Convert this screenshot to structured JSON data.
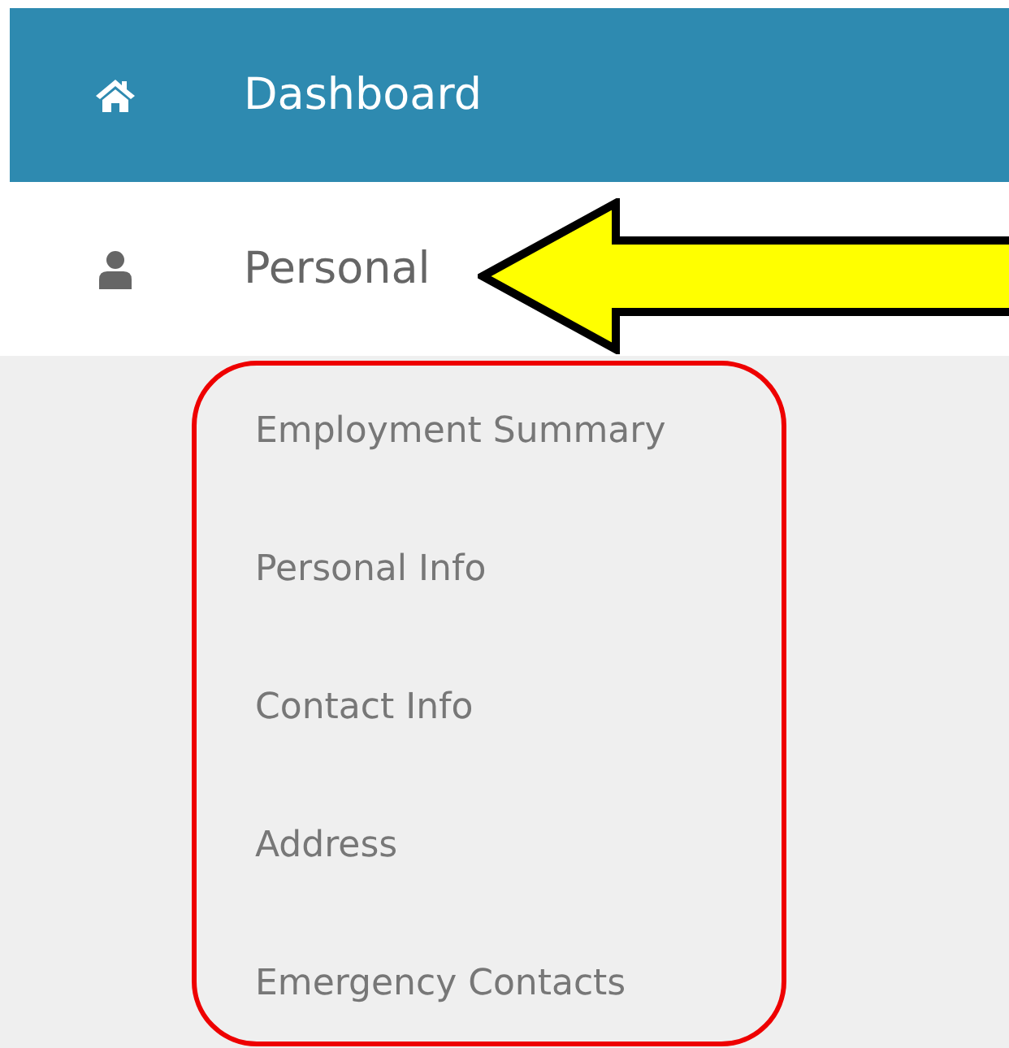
{
  "menu": [
    {
      "label": "Dashboard",
      "kind": "home",
      "selected": true
    },
    {
      "label": "Personal",
      "kind": "user",
      "selected": false,
      "children": [
        {
          "label": "Employment Summary"
        },
        {
          "label": "Personal Info"
        },
        {
          "label": "Contact Info"
        },
        {
          "label": "Address"
        },
        {
          "label": "Emergency Contacts"
        }
      ]
    }
  ]
}
